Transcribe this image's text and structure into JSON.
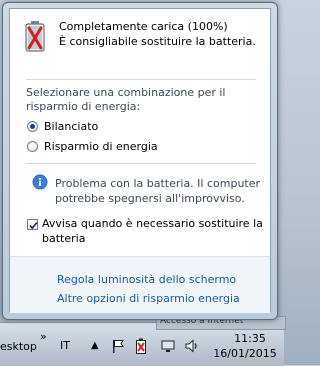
{
  "battery": {
    "status_title": "Completamente carica (100%)",
    "status_text": "È consigliabile sostituire la batteria."
  },
  "power_plans": {
    "caption": "Selezionare una combinazione per il risparmio di energia:",
    "options": [
      {
        "label": "Bilanciato",
        "selected": true
      },
      {
        "label": "Risparmio di energia",
        "selected": false
      }
    ]
  },
  "warning": {
    "icon": "info-icon",
    "text": "Problema con la batteria. Il computer potrebbe spegnersi all'improvviso."
  },
  "notify_checkbox": {
    "label": "Avvisa quando è necessario sostituire la batteria",
    "checked": true
  },
  "links": {
    "brightness": "Regola luminosità dello schermo",
    "more_options": "Altre opzioni di risparmio energia"
  },
  "taskbar": {
    "desktop_label": "esktop",
    "chevron": "»",
    "language": "IT",
    "show_hidden": "▲",
    "time": "11:35",
    "date": "16/01/2015",
    "background_window_text": "Accesso a Internet"
  },
  "colors": {
    "link": "#1e5b9e",
    "caption": "#3a4a5a",
    "battery_warning": "#d21f1f"
  }
}
